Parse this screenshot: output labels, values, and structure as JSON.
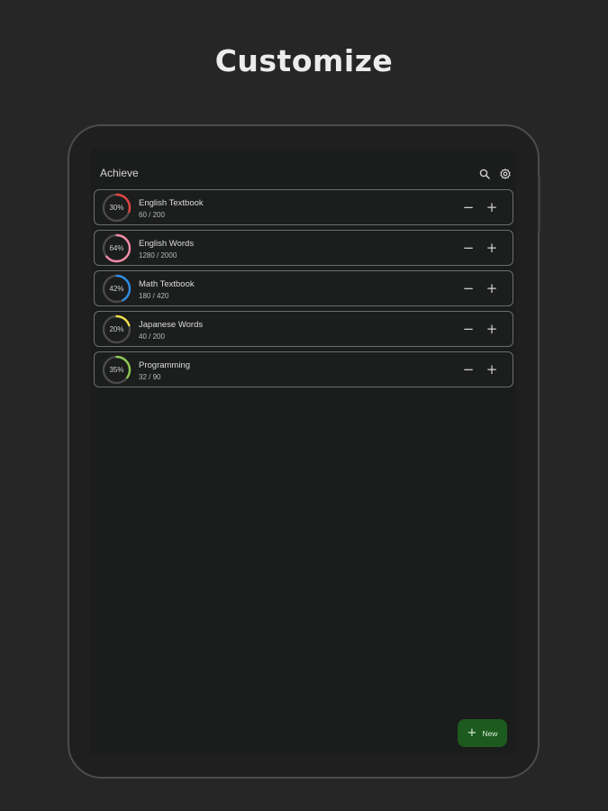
{
  "headline": "Customize",
  "app": {
    "title": "Achieve",
    "search_icon": "search-icon",
    "settings_icon": "gear-icon"
  },
  "goals": [
    {
      "name": "English Textbook",
      "count": "60 / 200",
      "percent_label": "30%",
      "progress": 0.3,
      "color": "#e0453f"
    },
    {
      "name": "English Words",
      "count": "1280 / 2000",
      "percent_label": "64%",
      "progress": 0.64,
      "color": "#f08ca7"
    },
    {
      "name": "Math Textbook",
      "count": "180 / 420",
      "percent_label": "42%",
      "progress": 0.42,
      "color": "#2f8de0"
    },
    {
      "name": "Japanese Words",
      "count": "40 / 200",
      "percent_label": "20%",
      "progress": 0.2,
      "color": "#f0e04a"
    },
    {
      "name": "Programming",
      "count": "32 / 90",
      "percent_label": "35%",
      "progress": 0.35,
      "color": "#8cc751"
    }
  ],
  "stepper": {
    "minus": "−",
    "plus": "+"
  },
  "fab": {
    "icon": "+",
    "label": "New",
    "color": "#1c5a1d"
  },
  "colors": {
    "background": "#262626",
    "screen": "#1b1c1c",
    "ring_track": "#4a4a4a"
  }
}
